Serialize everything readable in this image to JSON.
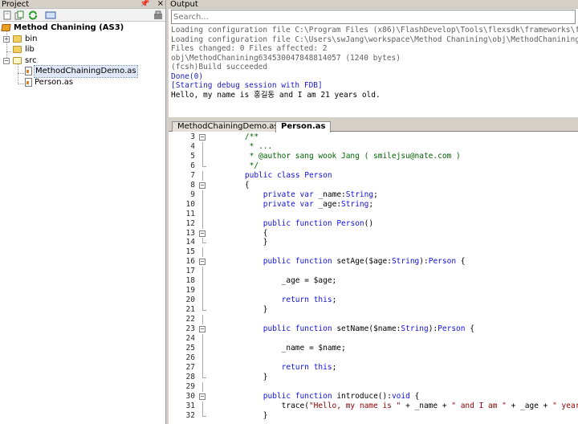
{
  "project": {
    "title": "Project",
    "pin_glyph": "📌",
    "close_glyph": "×",
    "toolbar_icons": [
      "new-file-icon",
      "copy-icon",
      "refresh-icon",
      "view-icon",
      "settings-icon"
    ],
    "tree": [
      {
        "label": "Method Chanining (AS3)",
        "icon": "package-icon",
        "bold": true,
        "depth": 0
      },
      {
        "label": "bin",
        "icon": "folder-icon",
        "expander": "+",
        "depth": 1
      },
      {
        "label": "lib",
        "icon": "folder-icon",
        "depth": 1
      },
      {
        "label": "src",
        "icon": "folder-icon",
        "expander": "−",
        "depth": 1
      },
      {
        "label": "MethodChainingDemo.as",
        "icon": "as-file-icon",
        "depth": 2,
        "selected": true
      },
      {
        "label": "Person.as",
        "icon": "as-file-icon",
        "depth": 2
      }
    ]
  },
  "output": {
    "title": "Output",
    "search_placeholder": "Search...",
    "lines": [
      {
        "text": " Loading configuration file C:\\Program Files (x86)\\FlashDevelop\\Tools\\flexsdk\\frameworks\\flex-con",
        "tone": "gray"
      },
      {
        "text": "Loading configuration file C:\\Users\\swJang\\workspace\\Method Chanining\\obj\\MethodChaniningConfig.x",
        "tone": "gray"
      },
      {
        "text": "Files changed: 0 Files affected: 2",
        "tone": "gray"
      },
      {
        "text": "obj\\MethodChanining634530047848814057 (1240 bytes)",
        "tone": "gray"
      },
      {
        "text": "(fcsh)Build succeeded",
        "tone": "gray"
      },
      {
        "text": "Done(0)",
        "tone": "blue"
      },
      {
        "text": "[Starting debug session with FDB]",
        "tone": "blue"
      },
      {
        "text": "Hello, my name is 홍길동 and I am 21 years old.",
        "tone": "black"
      }
    ]
  },
  "editor": {
    "tabs": [
      {
        "label": "MethodChainingDemo.as",
        "active": false
      },
      {
        "label": "Person.as",
        "active": true
      }
    ],
    "lines": [
      {
        "n": "3",
        "fold": "−",
        "code": "\t/**",
        "cls": "cm"
      },
      {
        "n": "4",
        "code": "\t * ...",
        "cls": "cm"
      },
      {
        "n": "5",
        "code": "\t * @author sang wook Jang ( smilejsu@nate.com )",
        "cls": "cm"
      },
      {
        "n": "6",
        "code": "\t */",
        "cls": "cm",
        "end": true
      },
      {
        "n": "7",
        "code": "\tpublic class Person"
      },
      {
        "n": "8",
        "fold": "−",
        "code": "\t{"
      },
      {
        "n": "9",
        "code": "\t\tprivate var _name:String;"
      },
      {
        "n": "10",
        "code": "\t\tprivate var _age:String;"
      },
      {
        "n": "11",
        "code": ""
      },
      {
        "n": "12",
        "code": "\t\tpublic function Person()"
      },
      {
        "n": "13",
        "fold": "−",
        "code": "\t\t{"
      },
      {
        "n": "14",
        "code": "\t\t}",
        "end": true
      },
      {
        "n": "15",
        "code": ""
      },
      {
        "n": "16",
        "fold": "−",
        "code": "\t\tpublic function setAge($age:String):Person {"
      },
      {
        "n": "17",
        "code": ""
      },
      {
        "n": "18",
        "code": "\t\t\t_age = $age;"
      },
      {
        "n": "19",
        "code": ""
      },
      {
        "n": "20",
        "code": "\t\t\treturn this;"
      },
      {
        "n": "21",
        "code": "\t\t}",
        "end": true
      },
      {
        "n": "22",
        "code": ""
      },
      {
        "n": "23",
        "fold": "−",
        "code": "\t\tpublic function setName($name:String):Person {"
      },
      {
        "n": "24",
        "code": ""
      },
      {
        "n": "25",
        "code": "\t\t\t_name = $name;"
      },
      {
        "n": "26",
        "code": ""
      },
      {
        "n": "27",
        "code": "\t\t\treturn this;"
      },
      {
        "n": "28",
        "code": "\t\t}",
        "end": true
      },
      {
        "n": "29",
        "code": ""
      },
      {
        "n": "30",
        "fold": "−",
        "code": "\t\tpublic function introduce():void {"
      },
      {
        "n": "31",
        "code": "\t\t\ttrace(\"Hello, my name is \" + _name + \" and I am \" + _age + \" years old.\");"
      },
      {
        "n": "32",
        "code": "\t\t}",
        "end": true
      }
    ]
  }
}
